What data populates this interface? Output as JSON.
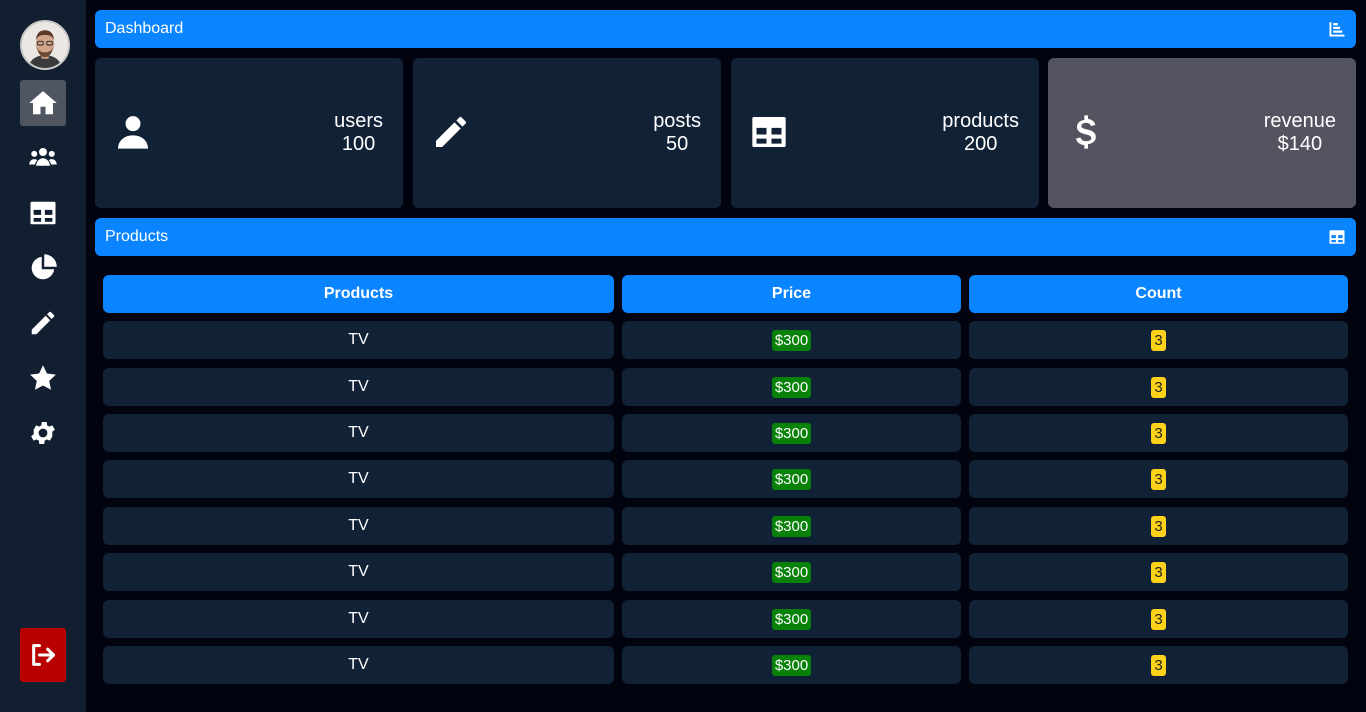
{
  "colors": {
    "background": "#01040f",
    "sidebar": "#111f30",
    "accent": "#0a84ff",
    "card": "#122236",
    "card_alt": "#545360",
    "logout": "#b90000",
    "price_badge": "#078107",
    "count_badge": "#ffd21a"
  },
  "sidebar": {
    "items": [
      {
        "icon": "home-icon",
        "active": true
      },
      {
        "icon": "users-icon",
        "active": false
      },
      {
        "icon": "table-icon",
        "active": false
      },
      {
        "icon": "pie-chart-icon",
        "active": false
      },
      {
        "icon": "pencil-icon",
        "active": false
      },
      {
        "icon": "star-icon",
        "active": false
      },
      {
        "icon": "gear-icon",
        "active": false
      }
    ],
    "logout_icon": "logout-icon"
  },
  "header": {
    "title": "Dashboard",
    "icon": "bar-chart-icon"
  },
  "stats": [
    {
      "label": "users",
      "value": "100",
      "icon": "user-icon"
    },
    {
      "label": "posts",
      "value": "50",
      "icon": "pencil-icon"
    },
    {
      "label": "products",
      "value": "200",
      "icon": "table-icon"
    },
    {
      "label": "revenue",
      "value": "$140",
      "icon": "dollar-icon"
    }
  ],
  "products_section": {
    "title": "Products",
    "icon": "table-icon"
  },
  "table": {
    "columns": [
      "Products",
      "Price",
      "Count"
    ],
    "rows": [
      {
        "product": "TV",
        "price": "$300",
        "count": "3"
      },
      {
        "product": "TV",
        "price": "$300",
        "count": "3"
      },
      {
        "product": "TV",
        "price": "$300",
        "count": "3"
      },
      {
        "product": "TV",
        "price": "$300",
        "count": "3"
      },
      {
        "product": "TV",
        "price": "$300",
        "count": "3"
      },
      {
        "product": "TV",
        "price": "$300",
        "count": "3"
      },
      {
        "product": "TV",
        "price": "$300",
        "count": "3"
      },
      {
        "product": "TV",
        "price": "$300",
        "count": "3"
      }
    ]
  }
}
